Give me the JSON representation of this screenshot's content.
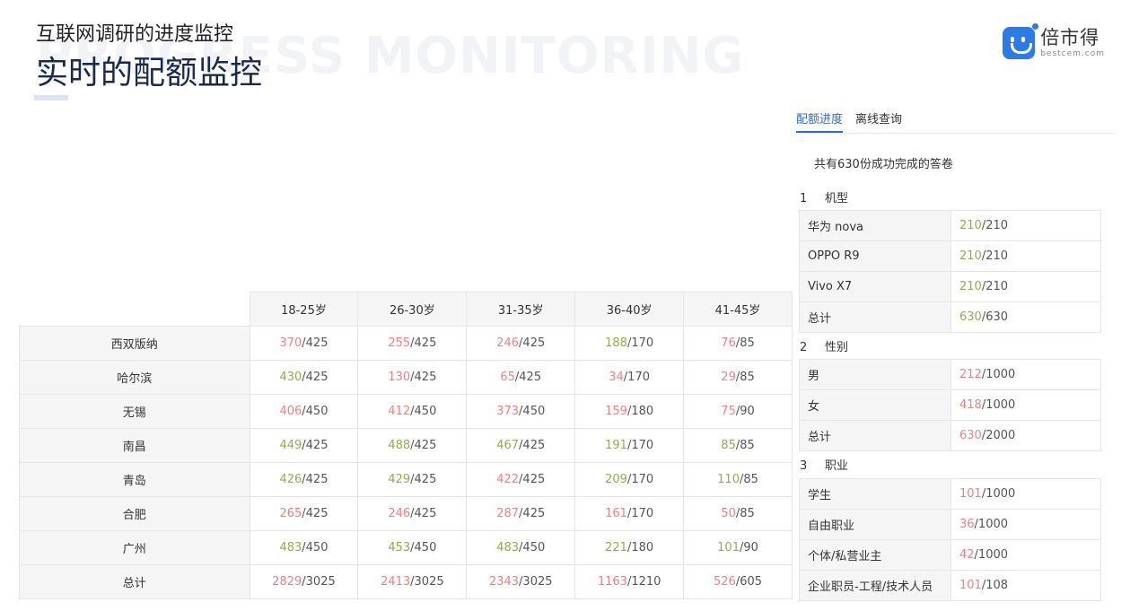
{
  "header": {
    "subtitle": "互联网调研的进度监控",
    "watermark": "PROGRESS MONITORING",
    "title": "实时的配额监控"
  },
  "logo": {
    "cn": "倍市得",
    "en": "bestcem.com",
    "icon": "smiley-chat-icon",
    "brand_color": "#2d7be5"
  },
  "colors": {
    "met": "#8db04a",
    "under": "#f08080",
    "tab_active": "#2d6bd2"
  },
  "quota_table": {
    "columns": [
      "18-25岁",
      "26-30岁",
      "31-35岁",
      "36-40岁",
      "41-45岁"
    ],
    "rows": [
      {
        "city": "西双版纳",
        "cells": [
          [
            "370",
            "/425",
            "low"
          ],
          [
            "255",
            "/425",
            "low"
          ],
          [
            "246",
            "/425",
            "low"
          ],
          [
            "188",
            "/170",
            "ok"
          ],
          [
            "76",
            "/85",
            "low"
          ]
        ]
      },
      {
        "city": "哈尔滨",
        "cells": [
          [
            "430",
            "/425",
            "ok"
          ],
          [
            "130",
            "/425",
            "low"
          ],
          [
            "65",
            "/425",
            "low"
          ],
          [
            "34",
            "/170",
            "low"
          ],
          [
            "29",
            "/85",
            "low"
          ]
        ]
      },
      {
        "city": "无锡",
        "cells": [
          [
            "406",
            "/450",
            "low"
          ],
          [
            "412",
            "/450",
            "low"
          ],
          [
            "373",
            "/450",
            "low"
          ],
          [
            "159",
            "/180",
            "low"
          ],
          [
            "75",
            "/90",
            "low"
          ]
        ]
      },
      {
        "city": "南昌",
        "cells": [
          [
            "449",
            "/425",
            "ok"
          ],
          [
            "488",
            "/425",
            "ok"
          ],
          [
            "467",
            "/425",
            "ok"
          ],
          [
            "191",
            "/170",
            "ok"
          ],
          [
            "85",
            "/85",
            "ok"
          ]
        ]
      },
      {
        "city": "青岛",
        "cells": [
          [
            "426",
            "/425",
            "ok"
          ],
          [
            "429",
            "/425",
            "ok"
          ],
          [
            "422",
            "/425",
            "low"
          ],
          [
            "209",
            "/170",
            "ok"
          ],
          [
            "110",
            "/85",
            "ok"
          ]
        ]
      },
      {
        "city": "合肥",
        "cells": [
          [
            "265",
            "/425",
            "low"
          ],
          [
            "246",
            "/425",
            "low"
          ],
          [
            "287",
            "/425",
            "low"
          ],
          [
            "161",
            "/170",
            "low"
          ],
          [
            "50",
            "/85",
            "low"
          ]
        ]
      },
      {
        "city": "广州",
        "cells": [
          [
            "483",
            "/450",
            "ok"
          ],
          [
            "453",
            "/450",
            "ok"
          ],
          [
            "483",
            "/450",
            "ok"
          ],
          [
            "221",
            "/180",
            "ok"
          ],
          [
            "101",
            "/90",
            "ok"
          ]
        ]
      },
      {
        "city": "总计",
        "cells": [
          [
            "2829",
            "/3025",
            "low"
          ],
          [
            "2413",
            "/3025",
            "low"
          ],
          [
            "2343",
            "/3025",
            "low"
          ],
          [
            "1163",
            "/1210",
            "low"
          ],
          [
            "526",
            "/605",
            "low"
          ]
        ]
      }
    ]
  },
  "panel": {
    "tabs": [
      "配额进度",
      "离线查询"
    ],
    "active_tab": 0,
    "summary": "共有630份成功完成的答卷",
    "sections": [
      {
        "num": "1",
        "title": "机型",
        "rows": [
          {
            "label": "华为 nova",
            "done": "210",
            "total": "/210",
            "status": "ok"
          },
          {
            "label": "OPPO R9",
            "done": "210",
            "total": "/210",
            "status": "ok"
          },
          {
            "label": "Vivo X7",
            "done": "210",
            "total": "/210",
            "status": "ok"
          },
          {
            "label": "总计",
            "done": "630",
            "total": "/630",
            "status": "ok"
          }
        ]
      },
      {
        "num": "2",
        "title": "性别",
        "rows": [
          {
            "label": "男",
            "done": "212",
            "total": "/1000",
            "status": "low"
          },
          {
            "label": "女",
            "done": "418",
            "total": "/1000",
            "status": "low"
          },
          {
            "label": "总计",
            "done": "630",
            "total": "/2000",
            "status": "low"
          }
        ]
      },
      {
        "num": "3",
        "title": "职业",
        "rows": [
          {
            "label": "学生",
            "done": "101",
            "total": "/1000",
            "status": "low"
          },
          {
            "label": "自由职业",
            "done": "36",
            "total": "/1000",
            "status": "low"
          },
          {
            "label": "个体/私营业主",
            "done": "42",
            "total": "/1000",
            "status": "low"
          },
          {
            "label": "企业职员-工程/技术人员",
            "done": "101",
            "total": "/108",
            "status": "low"
          }
        ]
      }
    ]
  }
}
